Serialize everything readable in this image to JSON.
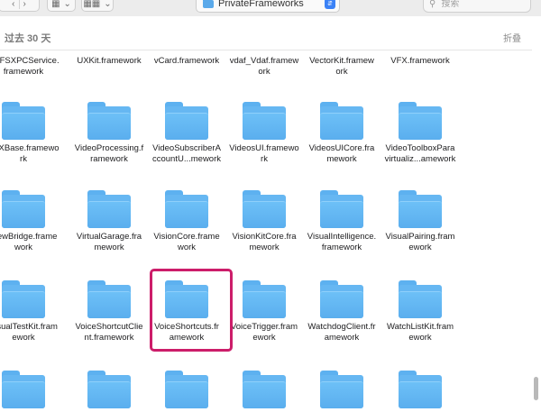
{
  "toolbar": {
    "back_icon": "chevron-left",
    "forward_icon": "chevron-right",
    "view_grid_icon": "grid",
    "view_group_icon": "grid-group",
    "dropdown_icon": "chevron-down",
    "path_title": "PrivateFrameworks",
    "search_placeholder": "搜索"
  },
  "section": {
    "title": "过去 30 天",
    "collapse_label": "折叠"
  },
  "items": [
    {
      "label": "UVFSXPCService.\nframework"
    },
    {
      "label": "UXKit.framework"
    },
    {
      "label": "vCard.framework"
    },
    {
      "label": "vdaf_Vdaf.framew\nork"
    },
    {
      "label": "VectorKit.framew\nork"
    },
    {
      "label": "VFX.framework"
    },
    {
      "label": "VFXBase.framewo\nrk"
    },
    {
      "label": "VideoProcessing.f\nramework"
    },
    {
      "label": "VideoSubscriberA\nccountU...mework"
    },
    {
      "label": "VideosUI.framewo\nrk"
    },
    {
      "label": "VideosUICore.fra\nmework"
    },
    {
      "label": "VideoToolboxPara\nvirtualiz...amework"
    },
    {
      "label": "ViewBridge.frame\nwork"
    },
    {
      "label": "VirtualGarage.fra\nmework"
    },
    {
      "label": "VisionCore.frame\nwork"
    },
    {
      "label": "VisionKitCore.fra\nmework"
    },
    {
      "label": "VisualIntelligence.\nframework"
    },
    {
      "label": "VisualPairing.fram\nework"
    },
    {
      "label": "VisualTestKit.fram\nework"
    },
    {
      "label": "VoiceShortcutClie\nnt.framework"
    },
    {
      "label": "VoiceShortcuts.fr\namework"
    },
    {
      "label": "VoiceTrigger.fram\nework"
    },
    {
      "label": "WatchdogClient.fr\namework"
    },
    {
      "label": "WatchListKit.fram\nework"
    },
    {
      "label": ""
    },
    {
      "label": ""
    },
    {
      "label": ""
    },
    {
      "label": ""
    },
    {
      "label": ""
    },
    {
      "label": ""
    }
  ],
  "colors": {
    "folder": "#66b7f2",
    "selection_highlight": "#cc1d6a"
  }
}
